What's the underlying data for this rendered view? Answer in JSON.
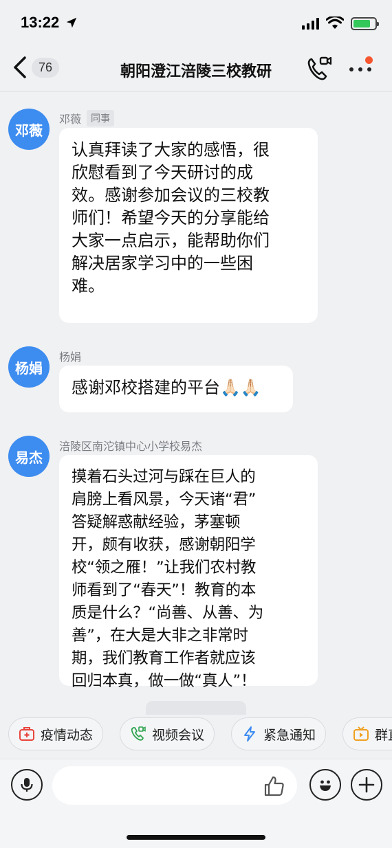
{
  "status_bar": {
    "time": "13:22"
  },
  "header": {
    "back_count": "76",
    "title": "朝阳澄江涪陵三校教研"
  },
  "messages": [
    {
      "avatar_text": "邓薇",
      "sender": "邓薇",
      "tag": "同事",
      "lines": [
        "认真拜读了大家的感悟，很",
        "欣慰看到了今天研讨的成",
        "效。感谢参加会议的三校教",
        "师们！希望今天的分享能给",
        "大家一点启示，能帮助你们",
        "解决居家学习中的一些困",
        "难。"
      ]
    },
    {
      "avatar_text": "杨娟",
      "sender": "杨娟",
      "lines": [
        "感谢邓校搭建的平台"
      ],
      "emoji": "🙏🏻🙏🏻"
    },
    {
      "avatar_text": "易杰",
      "sender": "涪陵区南沱镇中心小学校易杰",
      "lines": [
        "摸着石头过河与踩在巨人的",
        "肩膀上看风景，今天诸“君”",
        "答疑解惑献经验，茅塞顿",
        "开，颇有收获，感谢朝阳学",
        "校“领之雁！”让我们农村教",
        "师看到了“春天”！教育的本",
        "质是什么？“尚善、从善、为",
        "善”，在大是大非之非常时",
        "期，我们教育工作者就应该",
        "回归本真，做一做“真人”！"
      ]
    }
  ],
  "quick_actions": [
    {
      "label": "疫情动态",
      "icon": "first-aid-kit-icon",
      "color": "#e8453c"
    },
    {
      "label": "视频会议",
      "icon": "video-call-icon",
      "color": "#2ea44f"
    },
    {
      "label": "紧急通知",
      "icon": "lightning-icon",
      "color": "#3d8cf0"
    },
    {
      "label": "群直播",
      "icon": "tv-icon",
      "color": "#f0a020"
    }
  ],
  "input": {
    "placeholder": ""
  },
  "colors": {
    "avatar": "#3d8cf0",
    "accent_dot": "#f5562f",
    "background": "#f0f1f3"
  }
}
